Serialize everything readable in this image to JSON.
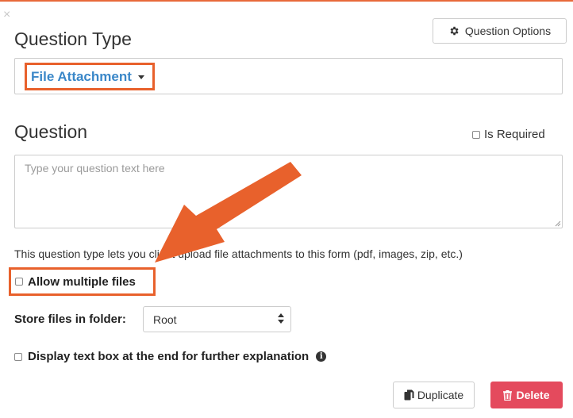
{
  "close_label": "×",
  "header": {
    "question_options_label": "Question Options",
    "question_type_heading": "Question Type"
  },
  "question_type": {
    "selected_value": "File Attachment"
  },
  "question": {
    "heading": "Question",
    "is_required_label": "Is Required",
    "textarea_placeholder": "Type your question text here",
    "textarea_value": ""
  },
  "helper_text": "This question type lets you client upload file attachments to this form (pdf, images, zip, etc.)",
  "options": {
    "allow_multiple_label": "Allow multiple files",
    "store_folder_label": "Store files in folder:",
    "store_folder_value": "Root",
    "display_textbox_label": "Display text box at the end for further explanation"
  },
  "actions": {
    "duplicate_label": "Duplicate",
    "delete_label": "Delete"
  },
  "icons": {
    "question_options": "gear-icon",
    "question_type_dropdown": "caret-down-icon",
    "folder_select": "up-down-arrows-icon",
    "explain_info": "info-circle-icon",
    "duplicate": "copy-icon",
    "delete": "trash-icon",
    "callout": "arrow-callout-icon"
  },
  "colors": {
    "accent_orange": "#e8612c",
    "link_blue": "#3a87c8",
    "delete_red": "#e44a5d"
  }
}
